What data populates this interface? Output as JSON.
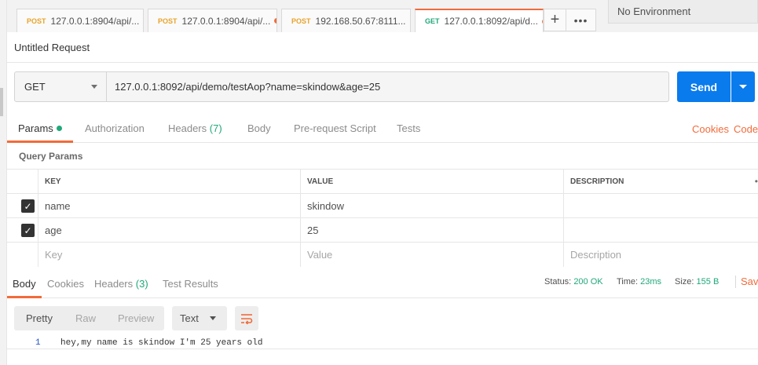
{
  "tabs": [
    {
      "method": "POST",
      "url": "127.0.0.1:8904/api/..."
    },
    {
      "method": "POST",
      "url": "127.0.0.1:8904/api/..."
    },
    {
      "method": "POST",
      "url": "192.168.50.67:8111..."
    },
    {
      "method": "GET",
      "url": "127.0.0.1:8092/api/d..."
    }
  ],
  "tab_add_icon": "plus-icon",
  "tab_more_icon": "ellipsis-icon",
  "environment": "No Environment",
  "request": {
    "title": "Untitled Request",
    "method": "GET",
    "url": "127.0.0.1:8092/api/demo/testAop?name=skindow&age=25",
    "send_label": "Send"
  },
  "request_tabs": {
    "params": "Params",
    "authorization": "Authorization",
    "headers": "Headers",
    "headers_count": "(7)",
    "body": "Body",
    "prerequest": "Pre-request Script",
    "tests": "Tests",
    "cookies": "Cookies",
    "code": "Code"
  },
  "query_params": {
    "label": "Query Params",
    "columns": {
      "key": "KEY",
      "value": "VALUE",
      "description": "DESCRIPTION"
    },
    "rows": [
      {
        "checked": true,
        "key": "name",
        "value": "skindow",
        "description": ""
      },
      {
        "checked": true,
        "key": "age",
        "value": "25",
        "description": ""
      }
    ],
    "placeholders": {
      "key": "Key",
      "value": "Value",
      "description": "Description"
    }
  },
  "response_tabs": {
    "body": "Body",
    "cookies": "Cookies",
    "headers": "Headers",
    "headers_count": "(3)",
    "test_results": "Test Results"
  },
  "response_meta": {
    "status_label": "Status:",
    "status_value": "200 OK",
    "time_label": "Time:",
    "time_value": "23ms",
    "size_label": "Size:",
    "size_value": "155 B",
    "save": "Save"
  },
  "response_toolbar": {
    "pretty": "Pretty",
    "raw": "Raw",
    "preview": "Preview",
    "format": "Text"
  },
  "response_body": [
    {
      "line": "1",
      "text": "hey,my name is skindow I'm 25 years old"
    }
  ],
  "colors": {
    "accent": "#f26b3a",
    "send": "#097bed",
    "success": "#20a87a",
    "post": "#e8a32a"
  }
}
